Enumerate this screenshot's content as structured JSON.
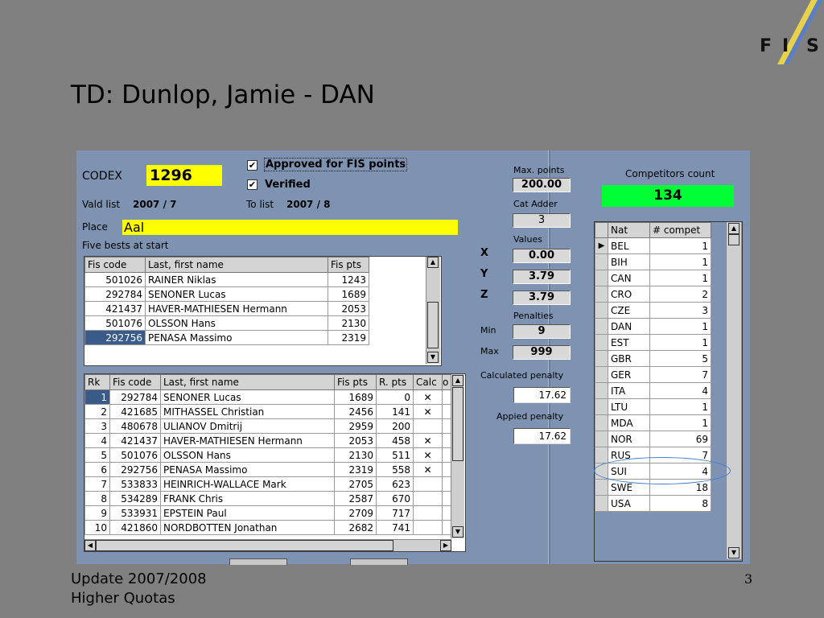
{
  "slide": {
    "title": "TD: Dunlop, Jamie - DAN",
    "footer_line1": "Update 2007/2008",
    "footer_line2": "Higher Quotas",
    "page_number": "3"
  },
  "logo": {
    "text_f": "F",
    "text_i": "I",
    "text_s": "S"
  },
  "form": {
    "codex_label": "CODEX",
    "codex_value": "1296",
    "approved_label": "Approved for FIS points",
    "approved_checked": "✔",
    "verified_label": "Verified",
    "verified_checked": "✔",
    "valid_list_label": "Vald list",
    "valid_list_value": "2007 / 7",
    "to_list_label": "To list",
    "to_list_value": "2007 / 8",
    "place_label": "Place",
    "place_value": "Aal",
    "five_bests_label": "Five bests at start"
  },
  "five_bests": {
    "headers": [
      "Fis code",
      "Last, first name",
      "Fis pts"
    ],
    "rows": [
      [
        "501026",
        "RAINER Niklas",
        "1243"
      ],
      [
        "292784",
        "SENONER Lucas",
        "1689"
      ],
      [
        "421437",
        "HAVER-MATHIESEN Hermann",
        "2053"
      ],
      [
        "501076",
        "OLSSON Hans",
        "2130"
      ],
      [
        "292756",
        "PENASA Massimo",
        "2319"
      ]
    ]
  },
  "results": {
    "headers": [
      "Rk",
      "Fis code",
      "Last, first name",
      "Fis pts",
      "R. pts",
      "Calc",
      "o"
    ],
    "rows": [
      [
        "1",
        "292784",
        "SENONER Lucas",
        "1689",
        "0",
        "✕"
      ],
      [
        "2",
        "421685",
        "MITHASSEL Christian",
        "2456",
        "141",
        "✕"
      ],
      [
        "3",
        "480678",
        "ULIANOV Dmitrij",
        "2959",
        "200",
        ""
      ],
      [
        "4",
        "421437",
        "HAVER-MATHIESEN Hermann",
        "2053",
        "458",
        "✕"
      ],
      [
        "5",
        "501076",
        "OLSSON Hans",
        "2130",
        "511",
        "✕"
      ],
      [
        "6",
        "292756",
        "PENASA Massimo",
        "2319",
        "558",
        "✕"
      ],
      [
        "7",
        "533833",
        "HEINRICH-WALLACE Mark",
        "2705",
        "623",
        ""
      ],
      [
        "8",
        "534289",
        "FRANK Chris",
        "2587",
        "670",
        ""
      ],
      [
        "9",
        "533931",
        "EPSTEIN Paul",
        "2709",
        "717",
        ""
      ],
      [
        "10",
        "421860",
        "NORDBOTTEN Jonathan",
        "2682",
        "741",
        ""
      ]
    ]
  },
  "calc": {
    "max_points_label": "Max. points",
    "max_points_value": "200.00",
    "cat_adder_label": "Cat Adder",
    "cat_adder_value": "3",
    "values_label": "Values",
    "x_label": "X",
    "x_value": "0.00",
    "y_label": "Y",
    "y_value": "3.79",
    "z_label": "Z",
    "z_value": "3.79",
    "penalties_label": "Penalties",
    "min_label": "Min",
    "min_value": "9",
    "max_label": "Max",
    "max_value": "999",
    "calculated_penalty_label": "Calculated penalty",
    "calculated_penalty_value": "17.62",
    "applied_penalty_label": "Appied penalty",
    "applied_penalty_value": "17.62"
  },
  "competitors": {
    "count_label": "Competitors count",
    "count_value": "134",
    "headers": [
      "Nat",
      "# compet"
    ],
    "rows": [
      [
        "BEL",
        "1"
      ],
      [
        "BIH",
        "1"
      ],
      [
        "CAN",
        "1"
      ],
      [
        "CRO",
        "2"
      ],
      [
        "CZE",
        "3"
      ],
      [
        "DAN",
        "1"
      ],
      [
        "EST",
        "1"
      ],
      [
        "GBR",
        "5"
      ],
      [
        "GER",
        "7"
      ],
      [
        "ITA",
        "4"
      ],
      [
        "LTU",
        "1"
      ],
      [
        "MDA",
        "1"
      ],
      [
        "NOR",
        "69"
      ],
      [
        "RUS",
        "7"
      ],
      [
        "SUI",
        "4"
      ],
      [
        "SWE",
        "18"
      ],
      [
        "USA",
        "8"
      ]
    ]
  },
  "colors": {
    "slide_bg": "#808080",
    "window_bg": "#7d93b1",
    "codex_highlight": "#ffff00",
    "count_highlight": "#00ff33",
    "ellipse": "#3c7dd6"
  }
}
